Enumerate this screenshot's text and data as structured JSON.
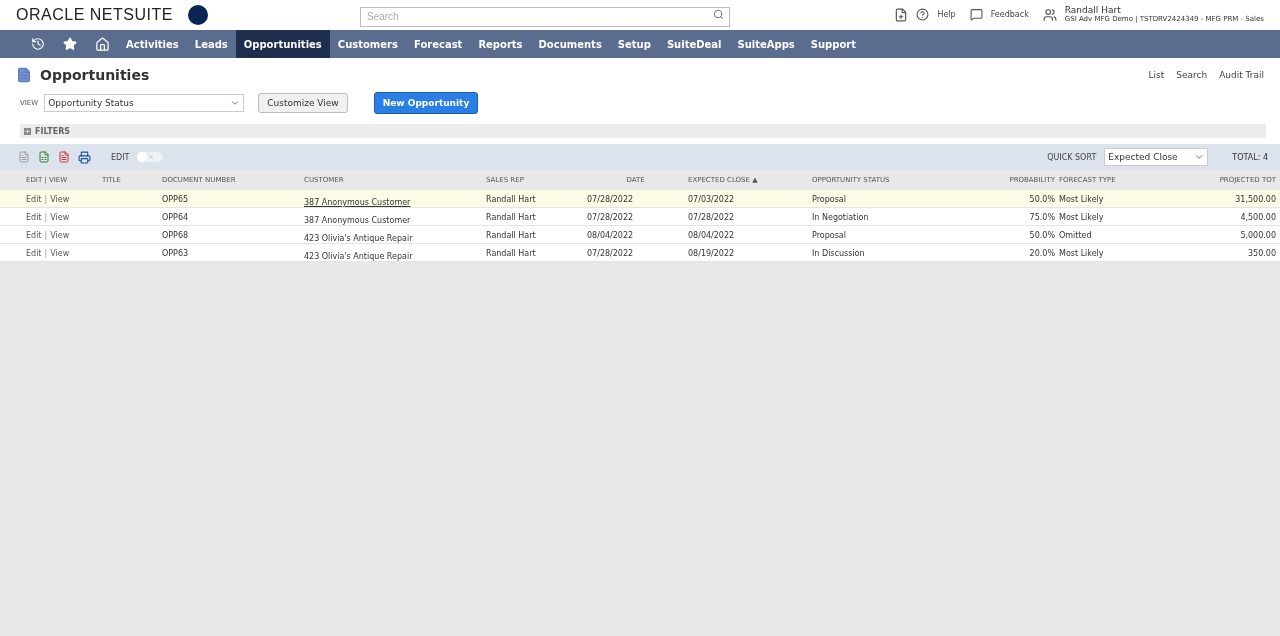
{
  "header": {
    "brand": "ORACLE NETSUITE",
    "search": {
      "placeholder": "Search"
    },
    "help": "Help",
    "feedback": "Feedback",
    "user": {
      "name": "Randall Hart",
      "account": "GSI Adv MFG Demo | TSTDRV2424349 - MFG PRM - Sales"
    }
  },
  "nav": [
    {
      "label": "Activities",
      "selected": false
    },
    {
      "label": "Leads",
      "selected": false
    },
    {
      "label": "Opportunities",
      "selected": true
    },
    {
      "label": "Customers",
      "selected": false
    },
    {
      "label": "Forecast",
      "selected": false
    },
    {
      "label": "Reports",
      "selected": false
    },
    {
      "label": "Documents",
      "selected": false
    },
    {
      "label": "Setup",
      "selected": false
    },
    {
      "label": "SuiteDeal",
      "selected": false
    },
    {
      "label": "SuiteApps",
      "selected": false
    },
    {
      "label": "Support",
      "selected": false
    }
  ],
  "page": {
    "title": "Opportunities",
    "links": [
      "List",
      "Search",
      "Audit Trail"
    ],
    "view_label": "VIEW",
    "view_value": "Opportunity Status",
    "customize": "Customize View",
    "new_button": "New Opportunity",
    "filters": "FILTERS"
  },
  "toolbar": {
    "edit_label": "EDIT",
    "edit_on": false,
    "quick_sort_label": "QUICK SORT",
    "quick_sort_value": "Expected Close",
    "total": "TOTAL: 4"
  },
  "table": {
    "columns": [
      {
        "label": "EDIT | VIEW",
        "kind": "text"
      },
      {
        "label": "TITLE",
        "kind": "text"
      },
      {
        "label": "DOCUMENT NUMBER",
        "kind": "text"
      },
      {
        "label": "CUSTOMER",
        "kind": "text"
      },
      {
        "label": "SALES REP",
        "kind": "text"
      },
      {
        "label": "DATE",
        "kind": "date"
      },
      {
        "label": "EXPECTED CLOSE",
        "kind": "text",
        "sort_indicator": "▲"
      },
      {
        "label": "OPPORTUNITY STATUS",
        "kind": "text"
      },
      {
        "label": "PROBABILITY",
        "kind": "number"
      },
      {
        "label": "FORECAST TYPE",
        "kind": "text"
      },
      {
        "label": "PROJECTED TOT",
        "kind": "number"
      }
    ],
    "rows": [
      {
        "selected": true,
        "edit": "Edit",
        "separator": "|",
        "view": "View",
        "document": "OPP65",
        "customer": "387 Anonymous Customer",
        "sales_rep": "Randall Hart",
        "date": "07/28/2022",
        "expected_close": "07/03/2022",
        "status": "Proposal",
        "probability": "50.0%",
        "forecast_type": "Most Likely",
        "projected_total": "31,500.00"
      },
      {
        "selected": false,
        "edit": "Edit",
        "separator": "|",
        "view": "View",
        "document": "OPP64",
        "customer": "387 Anonymous Customer",
        "sales_rep": "Randall Hart",
        "date": "07/28/2022",
        "expected_close": "07/28/2022",
        "status": "In Negotiation",
        "probability": "75.0%",
        "forecast_type": "Most Likely",
        "projected_total": "4,500.00"
      },
      {
        "selected": false,
        "edit": "Edit",
        "separator": "|",
        "view": "View",
        "document": "OPP68",
        "customer": "423 Olivia's Antique Repair",
        "sales_rep": "Randall Hart",
        "date": "08/04/2022",
        "expected_close": "08/04/2022",
        "status": "Proposal",
        "probability": "50.0%",
        "forecast_type": "Omitted",
        "projected_total": "5,000.00"
      },
      {
        "selected": false,
        "edit": "Edit",
        "separator": "|",
        "view": "View",
        "document": "OPP63",
        "customer": "423 Olivia's Antique Repair",
        "sales_rep": "Randall Hart",
        "date": "07/28/2022",
        "expected_close": "08/19/2022",
        "status": "In Discussion",
        "probability": "20.0%",
        "forecast_type": "Most Likely",
        "projected_total": "350.00"
      }
    ]
  }
}
